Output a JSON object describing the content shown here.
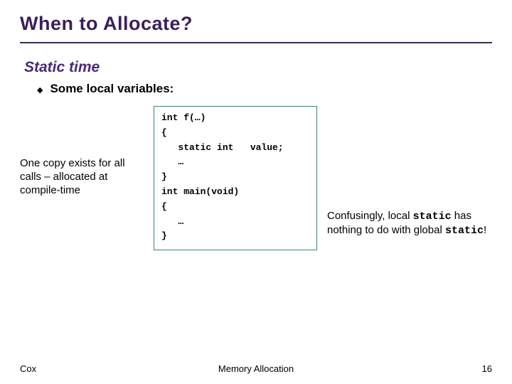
{
  "title": "When to Allocate?",
  "subhead": "Static time",
  "bullet": {
    "label": "Some local variables:"
  },
  "code": {
    "l1": "int f(…)",
    "l2": "{",
    "l3": "   static int   value;",
    "l4": "   …",
    "l5": "}",
    "l6": "int main(void)",
    "l7": "{",
    "l8": "   …",
    "l9": "}"
  },
  "left_anno": "One copy exists for all calls – allocated at compile-time",
  "right_anno": {
    "pre": "Confusingly, local ",
    "kw1": "static",
    "mid": " has nothing to do with global ",
    "kw2": "static",
    "post": "!"
  },
  "footer": {
    "left": "Cox",
    "center": "Memory Allocation",
    "right": "16"
  }
}
